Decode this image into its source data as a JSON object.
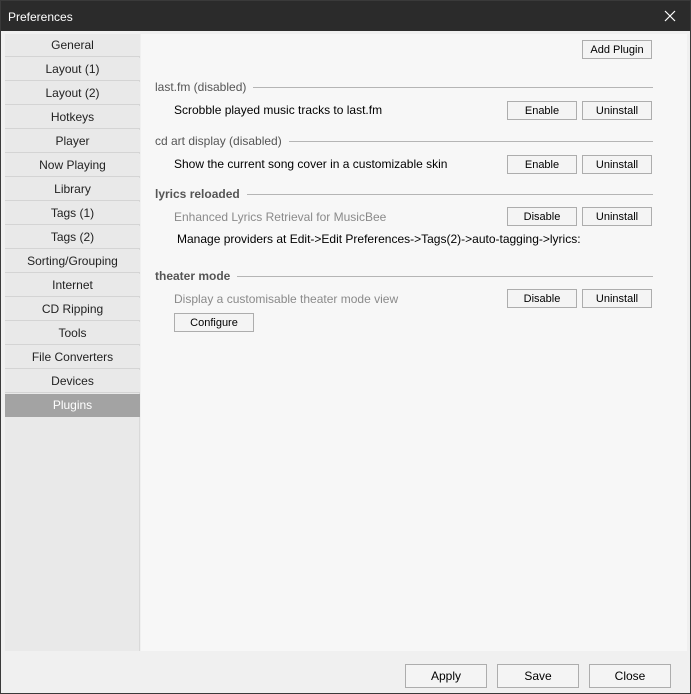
{
  "window": {
    "title": "Preferences"
  },
  "sidebar": {
    "items": [
      {
        "label": "General"
      },
      {
        "label": "Layout (1)"
      },
      {
        "label": "Layout (2)"
      },
      {
        "label": "Hotkeys"
      },
      {
        "label": "Player"
      },
      {
        "label": "Now Playing"
      },
      {
        "label": "Library"
      },
      {
        "label": "Tags (1)"
      },
      {
        "label": "Tags (2)"
      },
      {
        "label": "Sorting/Grouping"
      },
      {
        "label": "Internet"
      },
      {
        "label": "CD Ripping"
      },
      {
        "label": "Tools"
      },
      {
        "label": "File Converters"
      },
      {
        "label": "Devices"
      },
      {
        "label": "Plugins"
      }
    ],
    "selected": "Plugins"
  },
  "plugins": {
    "add_plugin_label": "Add Plugin",
    "items": [
      {
        "name": "last.fm (disabled)",
        "description": "Scrobble played music tracks to last.fm",
        "toggle_label": "Enable",
        "uninstall_label": "Uninstall"
      },
      {
        "name": "cd art display (disabled)",
        "description": "Show the current song cover in a customizable skin",
        "toggle_label": "Enable",
        "uninstall_label": "Uninstall"
      },
      {
        "name": "lyrics reloaded",
        "description": "Enhanced Lyrics Retrieval for MusicBee",
        "note": "Manage providers at Edit->Edit Preferences->Tags(2)->auto-tagging->lyrics:",
        "toggle_label": "Disable",
        "uninstall_label": "Uninstall"
      },
      {
        "name": "theater mode",
        "description": "Display a customisable theater mode view",
        "toggle_label": "Disable",
        "uninstall_label": "Uninstall",
        "configure_label": "Configure"
      }
    ]
  },
  "footer": {
    "apply_label": "Apply",
    "save_label": "Save",
    "close_label": "Close"
  }
}
